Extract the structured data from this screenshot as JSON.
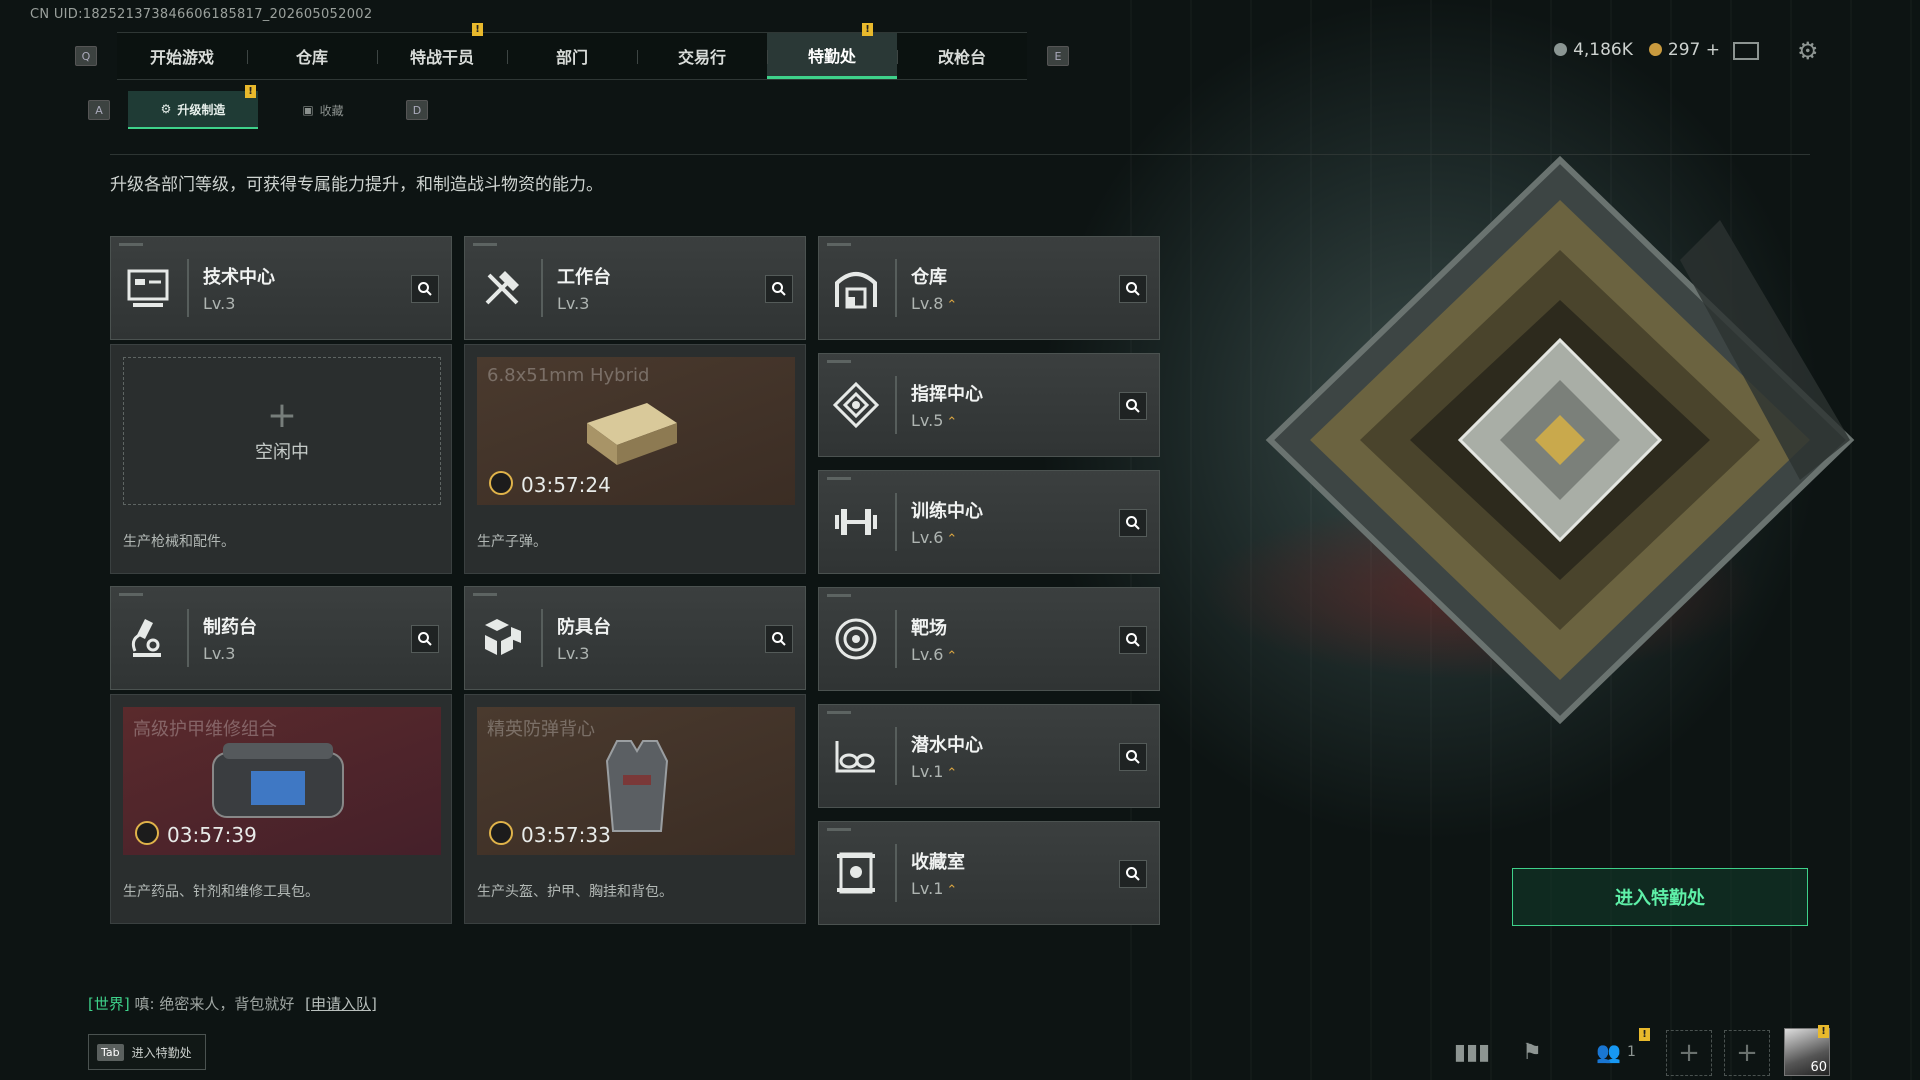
{
  "uid": "CN UID:18252137384660618581​7_202605052002",
  "nav": {
    "left_key": "Q",
    "right_key": "E",
    "tabs": [
      "开始游戏",
      "仓库",
      "特战干员",
      "部门",
      "交易行",
      "特勤处",
      "改枪台"
    ],
    "active_tab": "特勤处"
  },
  "subnav": {
    "left_key": "A",
    "right_key": "D",
    "tabs": [
      "升级制造",
      "收藏"
    ],
    "active": "升级制造"
  },
  "resources": {
    "silver": "4,186K",
    "gold": "297",
    "gold_add": "+"
  },
  "description": "升级各部门等级，可获得专属能力提升，和制造战斗物资的能力。",
  "departments": [
    {
      "name": "技术中心",
      "level": "Lv.3",
      "icon": "monitor-icon",
      "upgradable": false
    },
    {
      "name": "工作台",
      "level": "Lv.3",
      "icon": "tools-icon",
      "upgradable": false
    },
    {
      "name": "仓库",
      "level": "Lv.8",
      "icon": "warehouse-icon",
      "upgradable": true
    },
    {
      "name": "指挥中心",
      "level": "Lv.5",
      "icon": "command-icon",
      "upgradable": true
    },
    {
      "name": "训练中心",
      "level": "Lv.6",
      "icon": "dumbbell-icon",
      "upgradable": true
    },
    {
      "name": "制药台",
      "level": "Lv.3",
      "icon": "microscope-icon",
      "upgradable": false
    },
    {
      "name": "防具台",
      "level": "Lv.3",
      "icon": "armor-blocks-icon",
      "upgradable": false
    },
    {
      "name": "靶场",
      "level": "Lv.6",
      "icon": "target-icon",
      "upgradable": true
    },
    {
      "name": "潜水中心",
      "level": "Lv.1",
      "icon": "diving-goggles-icon",
      "upgradable": true
    },
    {
      "name": "收藏室",
      "level": "Lv.1",
      "icon": "collection-icon",
      "upgradable": true
    }
  ],
  "production": {
    "tech": {
      "status": "空闲中",
      "plus": "+",
      "desc": "生产枪械和配件。"
    },
    "workbench": {
      "item": "6.8x51mm Hybrid",
      "time": "03:57:24",
      "desc": "生产子弹。"
    },
    "pharmacy": {
      "item": "高级护甲维修组合",
      "time": "03:57:39",
      "desc": "生产药品、针剂和维修工具包。"
    },
    "armor": {
      "item": "精英防弹背心",
      "time": "03:57:33",
      "desc": "生产头盔、护甲、胸挂和背包。"
    }
  },
  "enter_button": "进入特勤处",
  "chat": {
    "channel": "[世界]",
    "sender": "嗔:",
    "message": "绝密来人，背包就好",
    "link": "[申请入队]"
  },
  "tab_hint": {
    "key": "Tab",
    "label": "进入特勤处"
  },
  "friends_count": "1",
  "player_level": "60",
  "colors": {
    "accent": "#3ed18a",
    "warning": "#e8b92c",
    "upgrade": "#d9a441"
  }
}
